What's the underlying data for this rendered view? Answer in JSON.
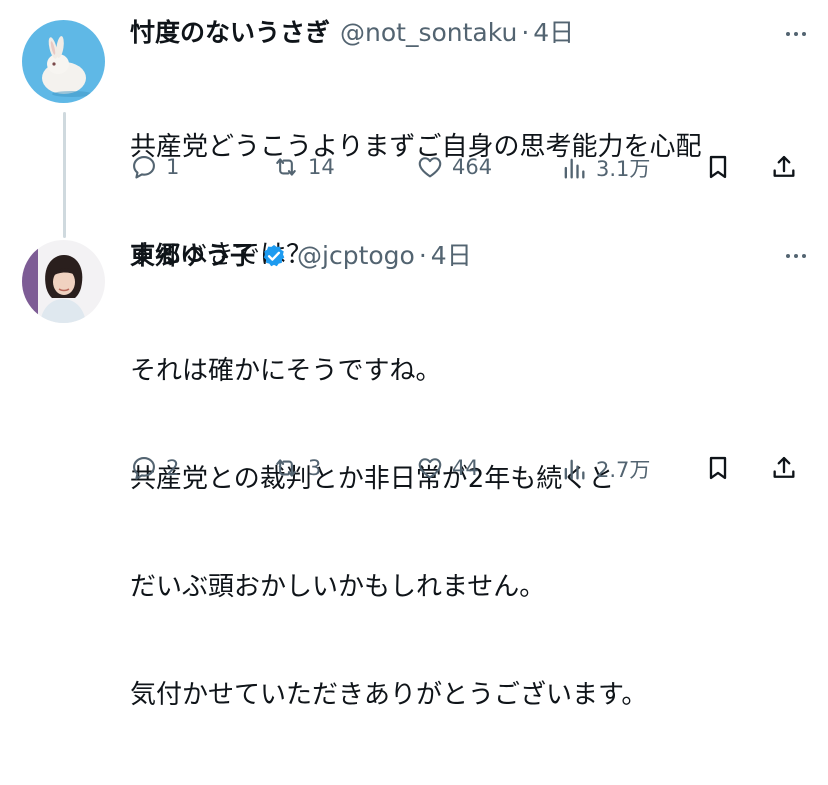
{
  "tweets": [
    {
      "name": "忖度のないうさぎ",
      "handle": "@not_sontaku",
      "time": "4日",
      "verified": false,
      "lines": [
        "共産党どうこうよりまずご自身の思考能力を心配",
        "するべきでは？"
      ],
      "replies": "1",
      "retweets": "14",
      "likes": "464",
      "views": "3.1万"
    },
    {
      "name": "東郷ゆう子",
      "handle": "@jcptogo",
      "time": "4日",
      "verified": true,
      "lines": [
        "それは確かにそうですね。",
        "共産党との裁判とか非日常が2年も続くと",
        "だいぶ頭おかしいかもしれません。",
        "気付かせていただきありがとうございます。"
      ],
      "replies": "2",
      "retweets": "3",
      "likes": "44",
      "views": "2.7万"
    }
  ],
  "colors": {
    "text": "#0f1419",
    "secondary": "#536471",
    "verified": "#1d9bf0",
    "thread_line": "#cfd9de"
  },
  "icons": [
    "rabbit-avatar",
    "woman-avatar",
    "verified-badge-icon",
    "more-icon",
    "reply-icon",
    "retweet-icon",
    "like-icon",
    "views-icon",
    "bookmark-icon",
    "share-icon"
  ]
}
